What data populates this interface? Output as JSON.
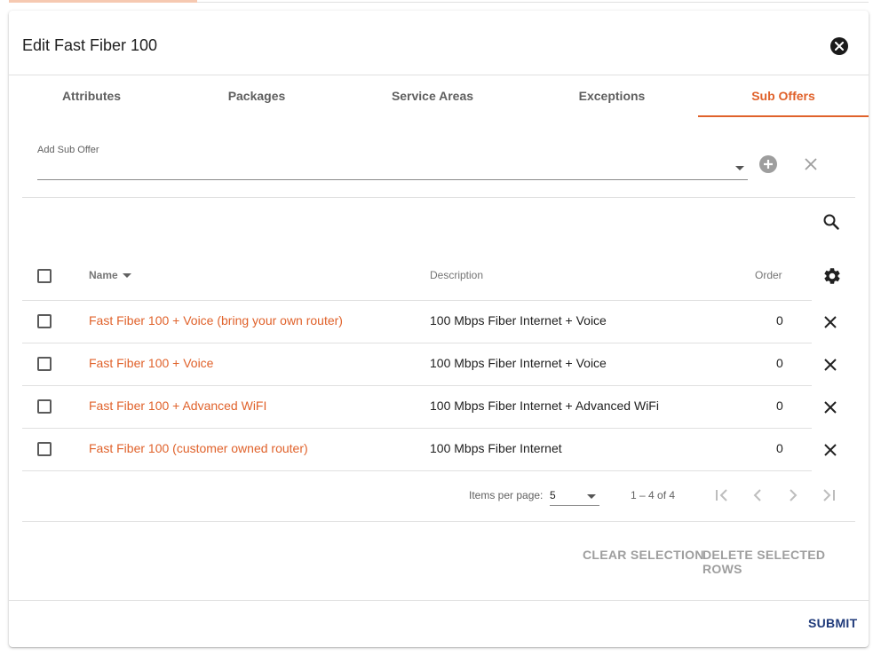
{
  "dialog": {
    "title": "Edit Fast Fiber 100",
    "close_icon": "close-circle-icon"
  },
  "tabs": [
    {
      "label": "Attributes",
      "active": false
    },
    {
      "label": "Packages",
      "active": false
    },
    {
      "label": "Service Areas",
      "active": false
    },
    {
      "label": "Exceptions",
      "active": false
    },
    {
      "label": "Sub Offers",
      "active": true
    }
  ],
  "add_sub_offer": {
    "label": "Add Sub Offer",
    "value": "",
    "add_icon": "add-circle-icon",
    "clear_icon": "close-icon"
  },
  "table": {
    "search_icon": "search-icon",
    "settings_icon": "gear-icon",
    "columns": {
      "name": "Name",
      "description": "Description",
      "order": "Order"
    },
    "rows": [
      {
        "name": "Fast Fiber 100 + Voice (bring your own router)",
        "description": "100 Mbps Fiber Internet + Voice",
        "order": "0"
      },
      {
        "name": "Fast Fiber 100 + Voice",
        "description": "100 Mbps Fiber Internet + Voice",
        "order": "0"
      },
      {
        "name": "Fast Fiber 100 + Advanced WiFI",
        "description": "100 Mbps Fiber Internet + Advanced WiFi",
        "order": "0"
      },
      {
        "name": "Fast Fiber 100 (customer owned router)",
        "description": "100 Mbps Fiber Internet",
        "order": "0"
      }
    ]
  },
  "paginator": {
    "items_per_page_label": "Items per page:",
    "items_per_page": "5",
    "range": "1 – 4 of 4"
  },
  "actions": {
    "clear_selection": "CLEAR SELECTION",
    "delete_selected": "DELETE SELECTED ROWS",
    "submit": "SUBMIT"
  },
  "colors": {
    "accent": "#e0622b",
    "submit": "#1f3a7a",
    "disabled": "#9e9e9e"
  }
}
